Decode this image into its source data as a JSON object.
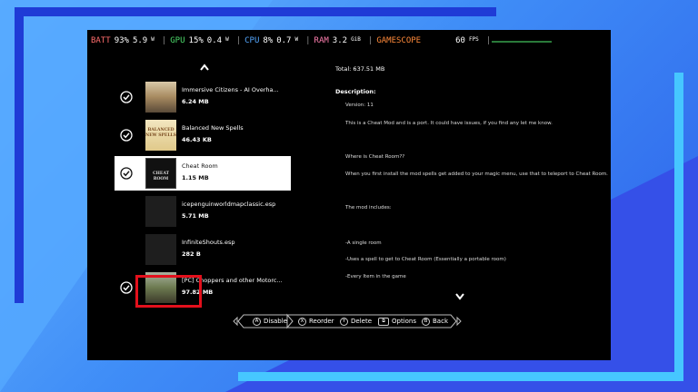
{
  "hud": {
    "batt_label": "BATT",
    "batt_pct": "93%",
    "batt_watts": "5.9",
    "watt_unit": "W",
    "gpu_label": "GPU",
    "gpu_pct": "15%",
    "gpu_watts": "0.4",
    "cpu_label": "CPU",
    "cpu_pct": "8%",
    "cpu_watts": "0.7",
    "ram_label": "RAM",
    "ram_value": "3.2",
    "ram_unit": "GiB",
    "gamescope_label": "GAMESCOPE",
    "fps_value": "60",
    "fps_unit": "FPS"
  },
  "total": "Total: 637.51 MB",
  "description": {
    "title": "Description:",
    "lines": [
      "Version: 11",
      "This is a Cheat Mod and is a port. It could have issues,  if you find any let me know.",
      "Where is Cheat Room??",
      "When you first install the mod spells get added to your magic menu, use that to teleport to Cheat Room.",
      "The mod includes:",
      "-A single room",
      "-Uses a spell to get to Cheat Room (Essentially a portable room)",
      "-Every Item in the game"
    ]
  },
  "mods": [
    {
      "name": "Immersive Citizens - AI Overha...",
      "size": "6.24 MB",
      "enabled": true,
      "selected": false,
      "thumb": "citizens"
    },
    {
      "name": "Balanced New Spells",
      "size": "46.43 KB",
      "enabled": true,
      "selected": false,
      "thumb": "spells",
      "thumb_text": "BALANCED NEW SPELLS"
    },
    {
      "name": "Cheat Room",
      "size": "1.15 MB",
      "enabled": true,
      "selected": true,
      "thumb": "cheatroom",
      "thumb_text": "CHEAT ROOM"
    },
    {
      "name": "icepenguinworldmapclassic.esp",
      "size": "5.71 MB",
      "enabled": false,
      "selected": false,
      "thumb": "blank"
    },
    {
      "name": "InfiniteShouts.esp",
      "size": "282 B",
      "enabled": false,
      "selected": false,
      "thumb": "blank"
    },
    {
      "name": "[PC] Choppers and other Motorc...",
      "size": "97.82 MB",
      "enabled": true,
      "selected": false,
      "thumb": "choppers"
    }
  ],
  "buttons": {
    "disable": {
      "key": "A",
      "label": "Disable"
    },
    "reorder": {
      "key": "X",
      "label": "Reorder"
    },
    "delete": {
      "key": "Y",
      "label": "Delete"
    },
    "options": {
      "key": "⧉",
      "label": "Options"
    },
    "back": {
      "key": "B",
      "label": "Back"
    }
  },
  "colors": {
    "highlight": "#e3101c",
    "selected_row": "#ffffff"
  }
}
